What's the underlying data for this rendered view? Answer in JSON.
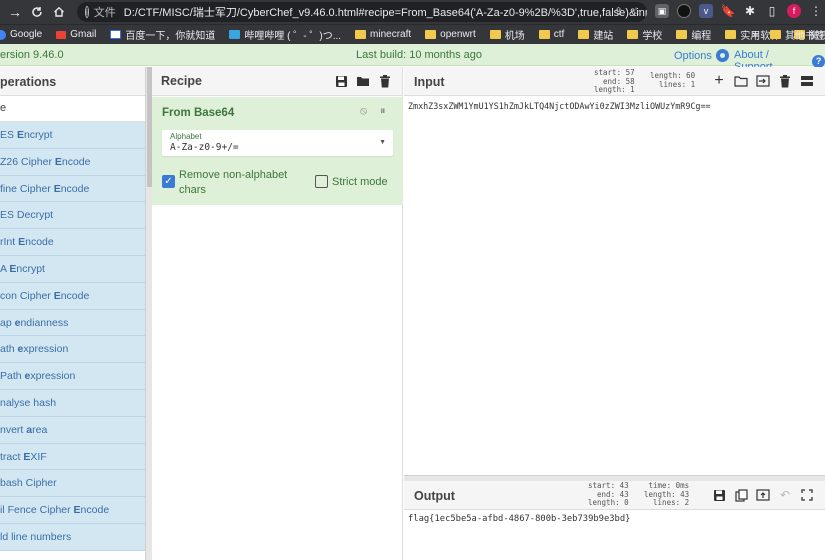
{
  "browser": {
    "file_label": "文件",
    "url": "D:/CTF/MISC/瑞士军刀/CyberChef_v9.46.0.html#recipe=From_Base64('A-Za-z0-9%2B/%3D',true,false)&inp...",
    "profile_initial": "f",
    "bookmarks": [
      "Google",
      "Gmail",
      "百度一下，你就知道",
      "哔哩哔哩 ( ゜- ゜)つ...",
      "minecraft",
      "openwrt",
      "机场",
      "ctf",
      "建站",
      "学校",
      "编程",
      "实用软件",
      "微视频"
    ],
    "other_bookmarks": "其他书签",
    "chevron": "»"
  },
  "banner": {
    "version": "ersion 9.46.0",
    "last_build": "Last build: 10 months ago",
    "options": "Options",
    "about": "About / Support"
  },
  "operations": {
    "header": "perations",
    "search_value": "e",
    "items": [
      {
        "pre": "ES ",
        "b": "E",
        "post": "ncrypt"
      },
      {
        "pre": "Z26 Cipher ",
        "b": "E",
        "post": "ncode"
      },
      {
        "pre": "fine Cipher ",
        "b": "E",
        "post": "ncode"
      },
      {
        "pre": "ES Decrypt",
        "b": "",
        "post": ""
      },
      {
        "pre": "rInt ",
        "b": "E",
        "post": "ncode"
      },
      {
        "pre": "A ",
        "b": "E",
        "post": "ncrypt"
      },
      {
        "pre": "con Cipher ",
        "b": "E",
        "post": "ncode"
      },
      {
        "pre": "ap ",
        "b": "e",
        "post": "ndianness"
      },
      {
        "pre": "ath ",
        "b": "e",
        "post": "xpression"
      },
      {
        "pre": "Path ",
        "b": "e",
        "post": "xpression"
      },
      {
        "pre": "nalyse hash",
        "b": "",
        "post": ""
      },
      {
        "pre": "nvert ",
        "b": "a",
        "post": "rea"
      },
      {
        "pre": "tract ",
        "b": "E",
        "post": "XIF"
      },
      {
        "pre": "bash Cipher",
        "b": "",
        "post": ""
      },
      {
        "pre": "il Fence Cipher ",
        "b": "E",
        "post": "ncode"
      },
      {
        "pre": "ld line numbers",
        "b": "",
        "post": ""
      }
    ]
  },
  "recipe": {
    "header": "Recipe",
    "operation": {
      "title": "From Base64",
      "alphabet_label": "Alphabet",
      "alphabet_value": "A-Za-z0-9+/=",
      "remove_non_alphabet_label": "Remove non-alphabet chars",
      "remove_non_alphabet_checked": true,
      "strict_mode_label": "Strict mode",
      "strict_mode_checked": false
    }
  },
  "input": {
    "header": "Input",
    "stats_left": [
      "start: 57",
      "end: 58",
      "length: 1"
    ],
    "stats_right": [
      "length: 60",
      "lines: 1"
    ],
    "text_before": "ZmxhZ3sxZWM1YmU1YS1hZmJkLTQ4NjctODAwYi0zZWI3MzliOWUzYmR9Cg",
    "text_highlight": "",
    "text_after": "=="
  },
  "output": {
    "header": "Output",
    "stats_left": [
      "start: 43",
      "end: 43",
      "length: 0"
    ],
    "stats_right": [
      "time: 0ms",
      "length: 43",
      "lines: 2"
    ],
    "text": "flag{1ec5be5a-afbd-4867-800b-3eb739b9e3bd}"
  },
  "colors": {
    "banner_bg": "#dff0d8",
    "ops_item_bg": "#d3e7f3",
    "accent_blue": "#3a7bd5",
    "green_text": "#3c763d"
  }
}
